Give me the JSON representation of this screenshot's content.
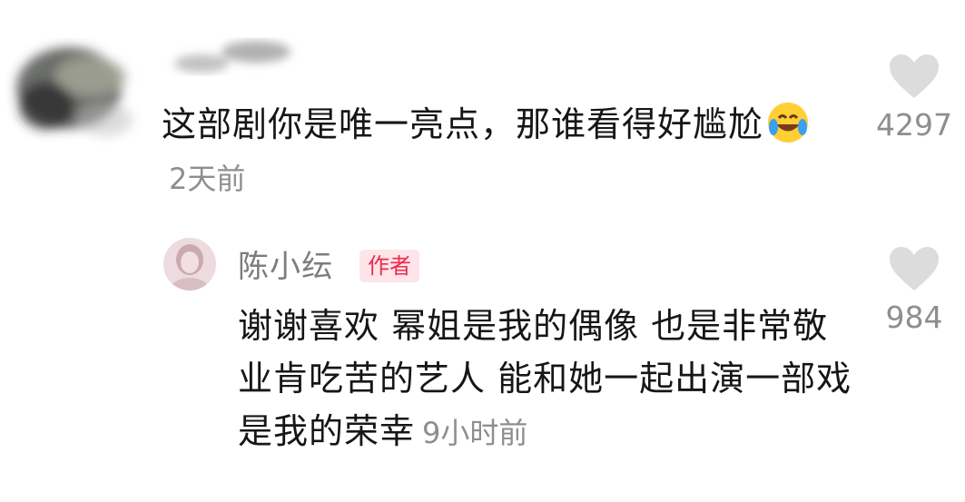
{
  "comment": {
    "text": "这部剧你是唯一亮点，那谁看得好尴尬",
    "emoji": "laughing-tears-emoji",
    "time": "2天前",
    "likes": "4297"
  },
  "reply": {
    "username": "陈小纭",
    "badge": "作者",
    "text": "谢谢喜欢 幂姐是我的偶像 也是非常敬业肯吃苦的艺人 能和她一起出演一部戏是我的荣幸",
    "time": "9小时前",
    "likes": "984"
  },
  "colors": {
    "text": "#161616",
    "meta": "#8e8e8e",
    "heart": "#dcdcdc",
    "badge_bg": "#fde5e9",
    "badge_text": "#f0294c"
  }
}
